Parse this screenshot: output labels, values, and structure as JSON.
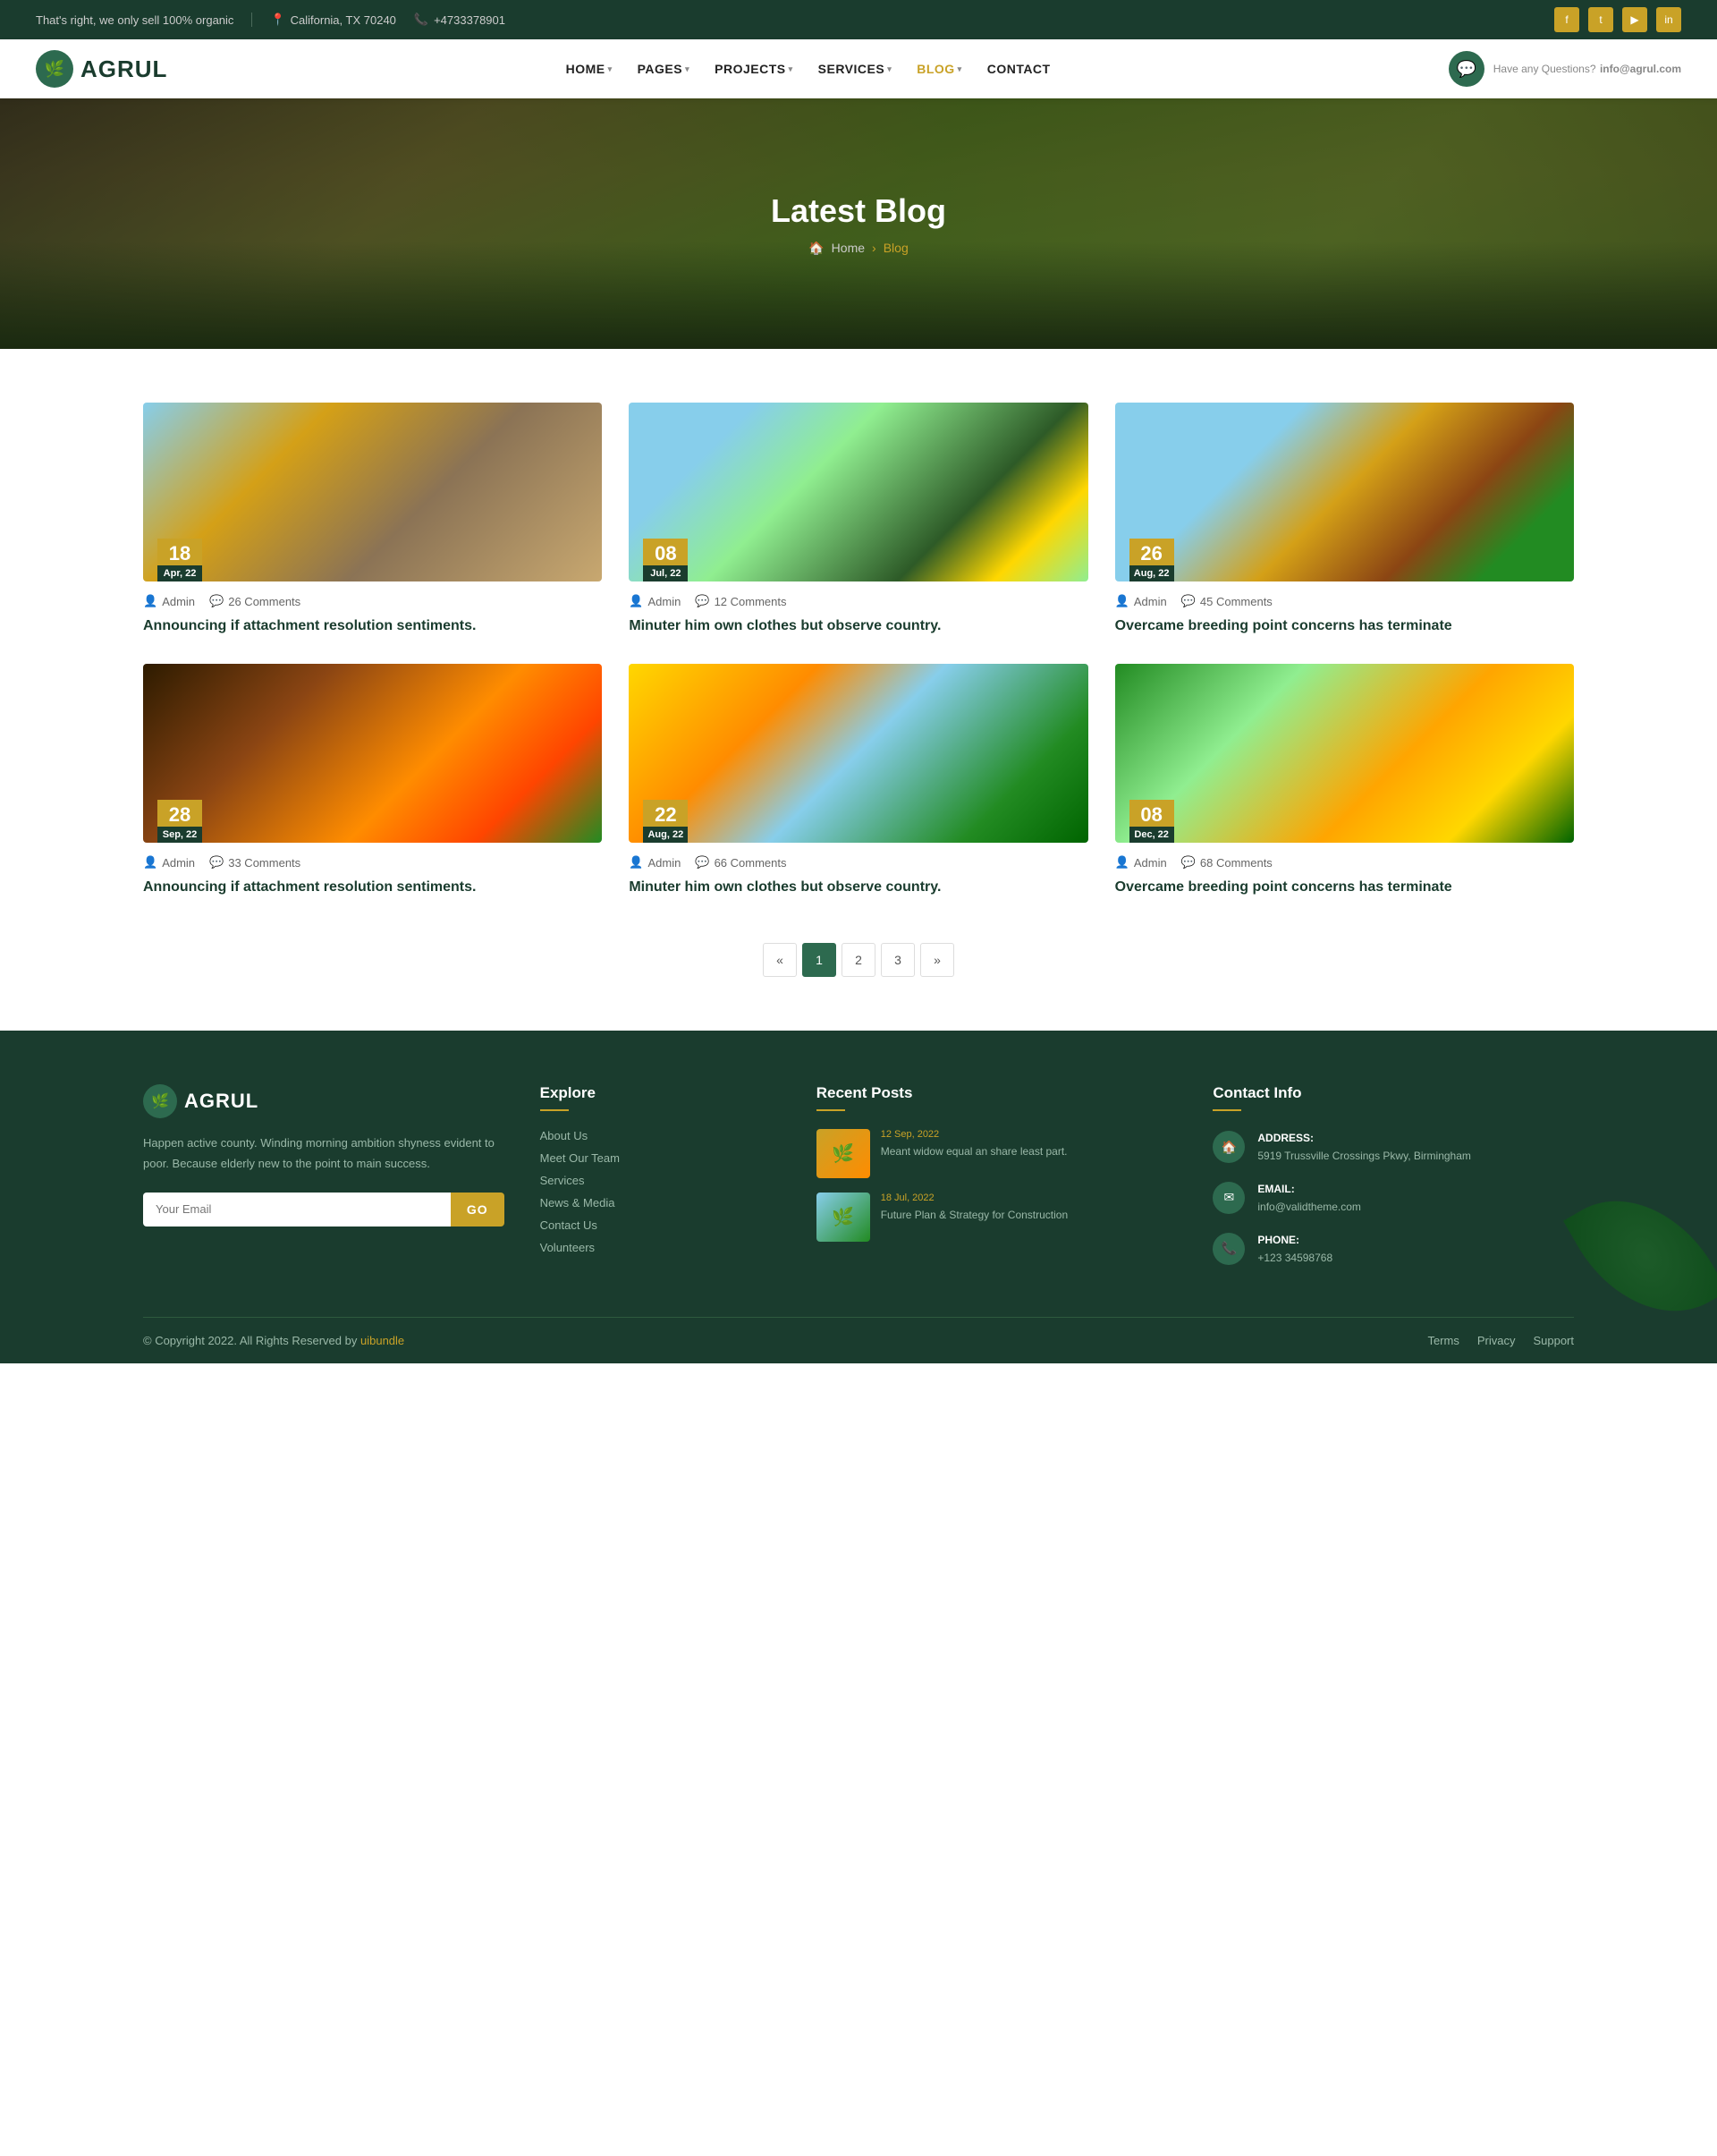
{
  "topBar": {
    "tagline": "That's right, we only sell 100% organic",
    "location": "California, TX 70240",
    "phone": "+4733378901",
    "socials": [
      "f",
      "t",
      "▶",
      "in"
    ]
  },
  "header": {
    "logo": {
      "text": "AGRUL",
      "icon": "🌿"
    },
    "nav": [
      {
        "label": "HOME",
        "hasDropdown": true
      },
      {
        "label": "PAGES",
        "hasDropdown": true
      },
      {
        "label": "PROJECTS",
        "hasDropdown": true
      },
      {
        "label": "SERVICES",
        "hasDropdown": true
      },
      {
        "label": "BLOG",
        "hasDropdown": true
      },
      {
        "label": "CONTACT",
        "hasDropdown": false
      }
    ],
    "contactIcon": "💬",
    "contactPrompt": "Have any Questions?",
    "contactEmail": "info@agrul.com"
  },
  "hero": {
    "title": "Latest Blog",
    "breadcrumb": {
      "home": "Home",
      "current": "Blog"
    }
  },
  "blog": {
    "posts": [
      {
        "id": 1,
        "dateNum": "18",
        "dateMonth": "Apr, 22",
        "author": "Admin",
        "comments": "26 Comments",
        "title": "Announcing if attachment resolution sentiments.",
        "imgClass": "img-farm"
      },
      {
        "id": 2,
        "dateNum": "08",
        "dateMonth": "Jul, 22",
        "author": "Admin",
        "comments": "12 Comments",
        "title": "Minuter him own clothes but observe country.",
        "imgClass": "img-field"
      },
      {
        "id": 3,
        "dateNum": "26",
        "dateMonth": "Aug, 22",
        "author": "Admin",
        "comments": "45 Comments",
        "title": "Overcame breeding point concerns has terminate",
        "imgClass": "img-tractor"
      },
      {
        "id": 4,
        "dateNum": "28",
        "dateMonth": "Sep, 22",
        "author": "Admin",
        "comments": "33 Comments",
        "title": "Announcing if attachment resolution sentiments.",
        "imgClass": "img-harvest"
      },
      {
        "id": 5,
        "dateNum": "22",
        "dateMonth": "Aug, 22",
        "author": "Admin",
        "comments": "66 Comments",
        "title": "Minuter him own clothes but observe country.",
        "imgClass": "img-sunset"
      },
      {
        "id": 6,
        "dateNum": "08",
        "dateMonth": "Dec, 22",
        "author": "Admin",
        "comments": "68 Comments",
        "title": "Overcame breeding point concerns has terminate",
        "imgClass": "img-citrus"
      }
    ],
    "pagination": {
      "prev": "«",
      "pages": [
        "1",
        "2",
        "3"
      ],
      "next": "»",
      "activePage": "1"
    }
  },
  "footer": {
    "logo": {
      "text": "AGRUL",
      "icon": "🌿"
    },
    "description": "Happen active county. Winding morning ambition shyness evident to poor. Because elderly new to the point to main success.",
    "emailPlaceholder": "Your Email",
    "goLabel": "GO",
    "explore": {
      "title": "Explore",
      "links": [
        "About Us",
        "Meet Our Team",
        "Services",
        "News & Media",
        "Contact Us",
        "Volunteers"
      ]
    },
    "recentPosts": {
      "title": "Recent Posts",
      "posts": [
        {
          "date": "12 Sep, 2022",
          "title": "Meant widow equal an share least part.",
          "thumbClass": "post-thumb-1"
        },
        {
          "date": "18 Jul, 2022",
          "title": "Future Plan & Strategy for Construction",
          "thumbClass": "post-thumb-2"
        }
      ]
    },
    "contactInfo": {
      "title": "Contact Info",
      "address": {
        "label": "ADDRESS:",
        "value": "5919 Trussville Crossings Pkwy, Birmingham"
      },
      "email": {
        "label": "EMAIL:",
        "value": "info@validtheme.com"
      },
      "phone": {
        "label": "PHONE:",
        "value": "+123 34598768"
      }
    },
    "copyright": "© Copyright 2022. All Rights Reserved by",
    "copyrightLink": "uibundle",
    "bottomLinks": [
      "Terms",
      "Privacy",
      "Support"
    ]
  }
}
